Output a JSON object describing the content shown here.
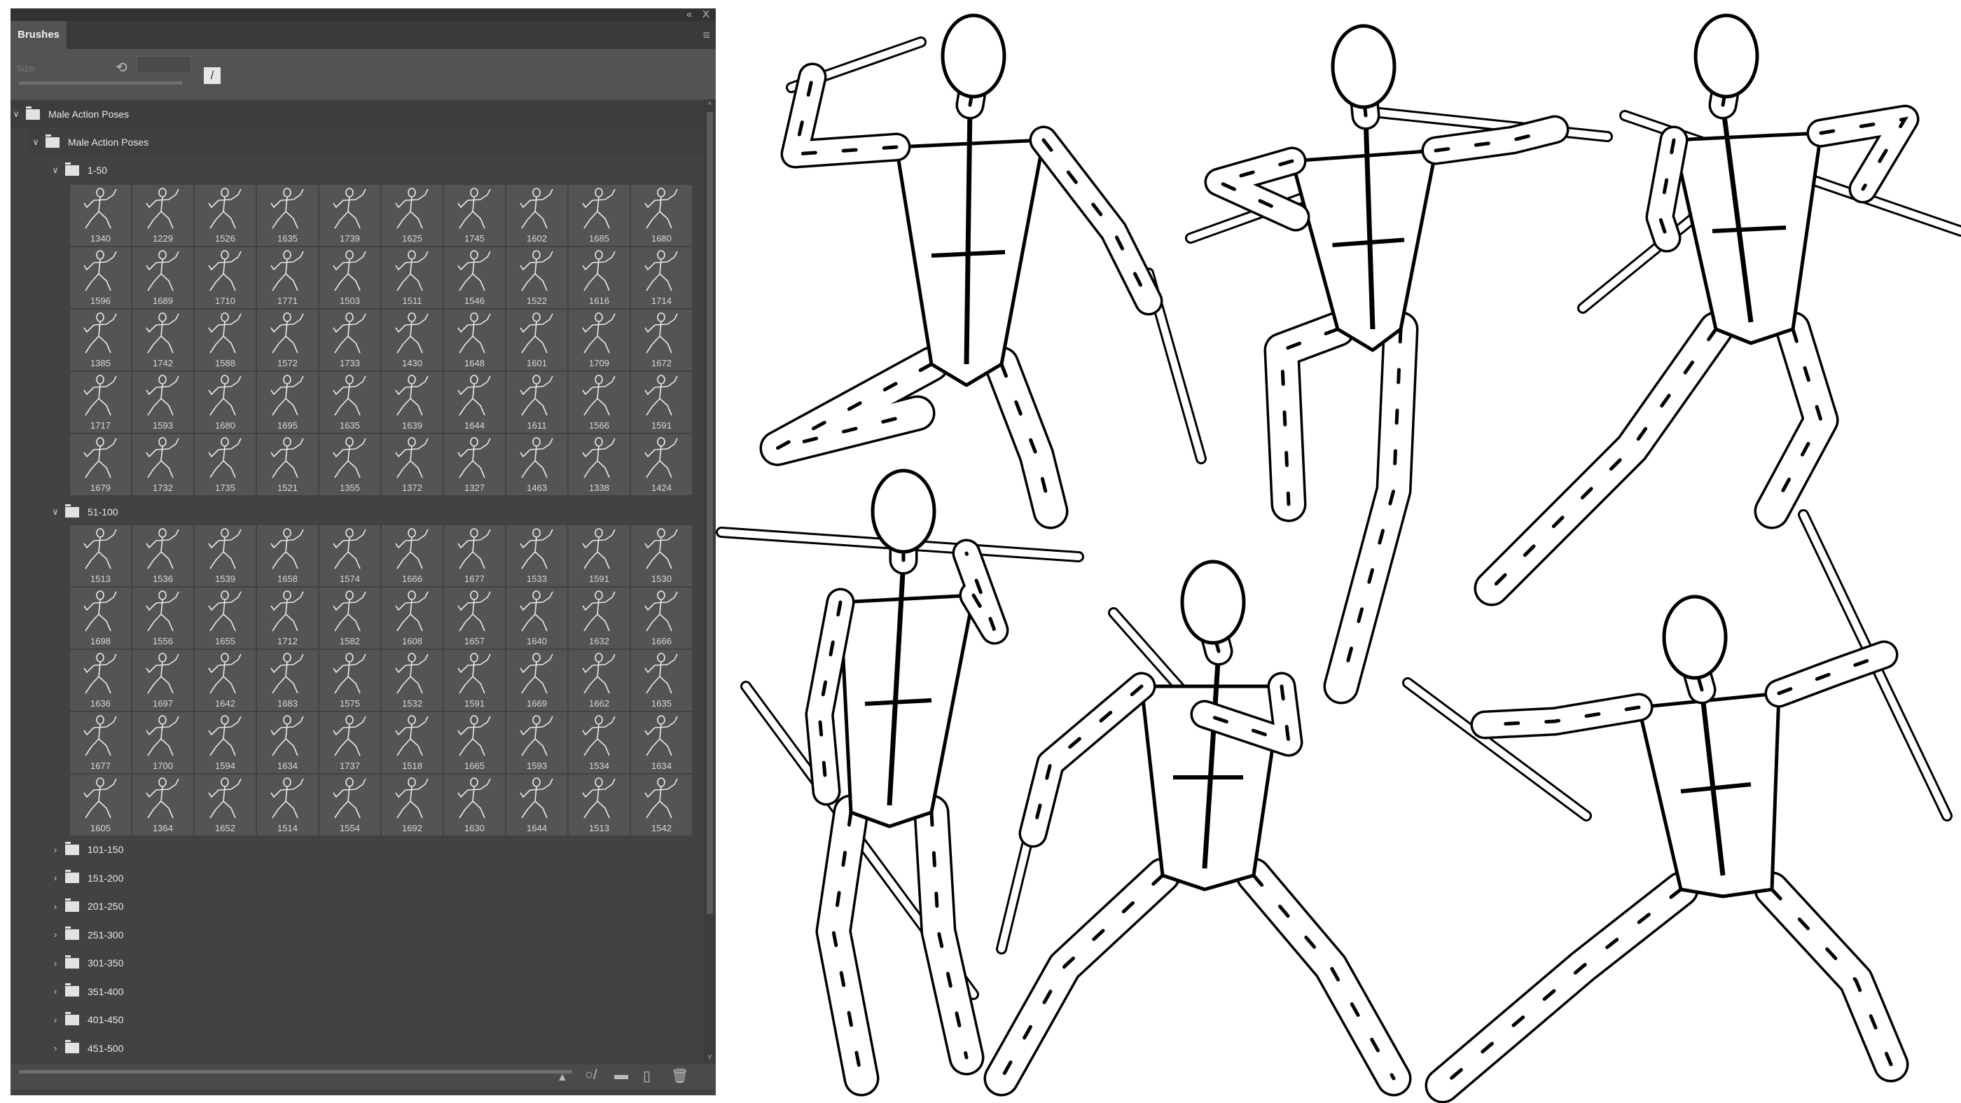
{
  "panel": {
    "tab_label": "Brushes",
    "size_label": "Size:",
    "top_controls": {
      "collapse": "«",
      "close": "X"
    },
    "menu_icon": "hamburger-menu-icon",
    "tree": {
      "root": "Male Action Poses",
      "sub": "Male Action Poses",
      "groups": [
        {
          "label": "1-50",
          "expanded": true,
          "brushes": [
            "1340",
            "1229",
            "1526",
            "1635",
            "1739",
            "1625",
            "1745",
            "1602",
            "1685",
            "1680",
            "1596",
            "1689",
            "1710",
            "1771",
            "1503",
            "1511",
            "1546",
            "1522",
            "1616",
            "1714",
            "1385",
            "1742",
            "1588",
            "1572",
            "1733",
            "1430",
            "1648",
            "1601",
            "1709",
            "1672",
            "1717",
            "1593",
            "1680",
            "1695",
            "1635",
            "1639",
            "1644",
            "1611",
            "1566",
            "1591",
            "1679",
            "1732",
            "1735",
            "1521",
            "1355",
            "1372",
            "1327",
            "1463",
            "1338",
            "1424"
          ]
        },
        {
          "label": "51-100",
          "expanded": true,
          "brushes": [
            "1513",
            "1536",
            "1539",
            "1658",
            "1574",
            "1666",
            "1677",
            "1533",
            "1591",
            "1530",
            "1698",
            "1556",
            "1655",
            "1712",
            "1582",
            "1608",
            "1657",
            "1640",
            "1632",
            "1666",
            "1636",
            "1697",
            "1642",
            "1683",
            "1575",
            "1532",
            "1591",
            "1669",
            "1662",
            "1635",
            "1677",
            "1700",
            "1594",
            "1634",
            "1737",
            "1518",
            "1665",
            "1593",
            "1534",
            "1634",
            "1605",
            "1364",
            "1652",
            "1514",
            "1554",
            "1692",
            "1630",
            "1644",
            "1513",
            "1542"
          ]
        }
      ],
      "collapsed_groups": [
        "101-150",
        "151-200",
        "201-250",
        "251-300",
        "301-350",
        "351-400",
        "401-450",
        "451-500"
      ]
    },
    "bottom_icons": [
      "brush-preview-icon",
      "toggle-brush-icon",
      "new-group-icon",
      "new-brush-icon",
      "delete-icon"
    ]
  },
  "colors": {
    "panel_bg": "#424242",
    "cell_bg": "#545454",
    "canvas_bg": "#ffffff",
    "ink": "#000000"
  }
}
